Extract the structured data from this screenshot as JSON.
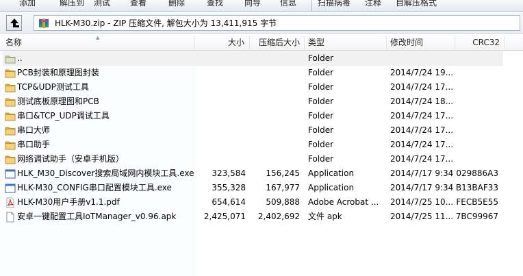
{
  "toolbar": {
    "buttons": [
      "添加",
      "解压到",
      "测试",
      "查看",
      "删除",
      "查找",
      "向导",
      "信息",
      "扫描病毒",
      "注释",
      "自解压格式"
    ]
  },
  "address": {
    "path": "HLK-M30.zip - ZIP 压缩文件, 解包大小为 13,411,915 字节"
  },
  "columns": {
    "name": "名称",
    "size": "大小",
    "packed": "压缩后大小",
    "type": "类型",
    "modified": "修改时间",
    "crc": "CRC32"
  },
  "rows": [
    {
      "icon": "parent-folder-icon",
      "name": "..",
      "size": "",
      "packed": "",
      "type": "Folder",
      "modified": "",
      "crc": ""
    },
    {
      "icon": "folder-icon",
      "name": "PCB封装和原理图封装",
      "size": "",
      "packed": "",
      "type": "Folder",
      "modified": "2014/7/24 19...",
      "crc": ""
    },
    {
      "icon": "folder-icon",
      "name": "TCP&UDP测试工具",
      "size": "",
      "packed": "",
      "type": "Folder",
      "modified": "2014/7/24 17...",
      "crc": ""
    },
    {
      "icon": "folder-icon",
      "name": "测试底板原理图和PCB",
      "size": "",
      "packed": "",
      "type": "Folder",
      "modified": "2014/7/24 18...",
      "crc": ""
    },
    {
      "icon": "folder-icon",
      "name": "串口&TCP_UDP调试工具",
      "size": "",
      "packed": "",
      "type": "Folder",
      "modified": "2014/7/24 17...",
      "crc": ""
    },
    {
      "icon": "folder-icon",
      "name": "串口大师",
      "size": "",
      "packed": "",
      "type": "Folder",
      "modified": "2014/7/24 17...",
      "crc": ""
    },
    {
      "icon": "folder-icon",
      "name": "串口助手",
      "size": "",
      "packed": "",
      "type": "Folder",
      "modified": "2014/7/24 17...",
      "crc": ""
    },
    {
      "icon": "folder-icon",
      "name": "网络调试助手（安卓手机版）",
      "size": "",
      "packed": "",
      "type": "Folder",
      "modified": "2014/7/24 17...",
      "crc": ""
    },
    {
      "icon": "application-icon",
      "name": "HLK_M30_Discover搜索局域网内模块工具.exe",
      "size": "323,584",
      "packed": "156,245",
      "type": "Application",
      "modified": "2014/7/17 9:34",
      "crc": "029886A3"
    },
    {
      "icon": "application-icon",
      "name": "HLK-M30_CONFIG串口配置模块工具.exe",
      "size": "355,328",
      "packed": "167,977",
      "type": "Application",
      "modified": "2014/7/17 9:34",
      "crc": "B13BAF33"
    },
    {
      "icon": "pdf-icon",
      "name": "HLK-M30用户手册v1.1.pdf",
      "size": "654,614",
      "packed": "509,888",
      "type": "Adobe Acrobat ...",
      "modified": "2014/7/25 10...",
      "crc": "FECB5E55"
    },
    {
      "icon": "file-icon",
      "name": "安卓一键配置工具IoTManager_v0.96.apk",
      "size": "2,425,071",
      "packed": "2,402,692",
      "type": "文件 apk",
      "modified": "2014/7/25 11...",
      "crc": "7BC99967"
    }
  ]
}
